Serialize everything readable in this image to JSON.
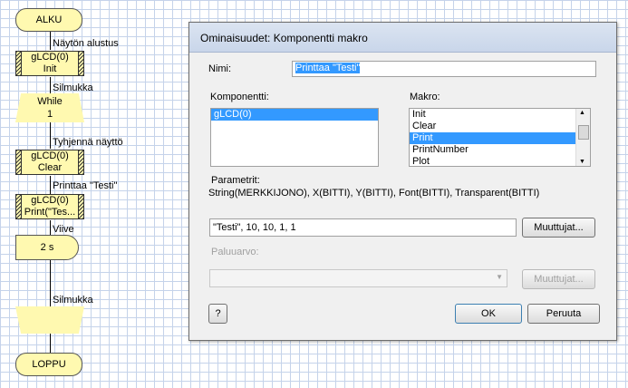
{
  "flowchart": {
    "start": "ALKU",
    "init_label": "Näytön alustus",
    "init_box": [
      "gLCD(0)",
      "Init"
    ],
    "loop_label": "Silmukka",
    "loop_box": [
      "While",
      "1"
    ],
    "clear_label": "Tyhjennä näyttö",
    "clear_box": [
      "gLCD(0)",
      "Clear"
    ],
    "print_label": "Printtaa \"Testi\"",
    "print_box": [
      "gLCD(0)",
      "Print(\"Tes..."
    ],
    "delay_label": "Viive",
    "delay_box": "2 s",
    "loop_end_label": "Silmukka",
    "end": "LOPPU"
  },
  "dialog": {
    "title": "Ominaisuudet: Komponentti makro",
    "name_label": "Nimi:",
    "name_value": "Printtaa \"Testi\"",
    "component_label": "Komponentti:",
    "components": [
      "gLCD(0)"
    ],
    "macro_label": "Makro:",
    "macros": [
      "Init",
      "Clear",
      "Print",
      "PrintNumber",
      "Plot"
    ],
    "selected_macro": "Print",
    "params_label": "Parametrit:",
    "params_signature": "String(MERKKIJONO), X(BITTI), Y(BITTI), Font(BITTI), Transparent(BITTI)",
    "params_value": "\"Testi\", 10, 10, 1, 1",
    "variables_button": "Muuttujat...",
    "return_label": "Paluuarvo:",
    "return_variables_button": "Muuttujat...",
    "help_button": "?",
    "ok_button": "OK",
    "cancel_button": "Peruuta"
  }
}
